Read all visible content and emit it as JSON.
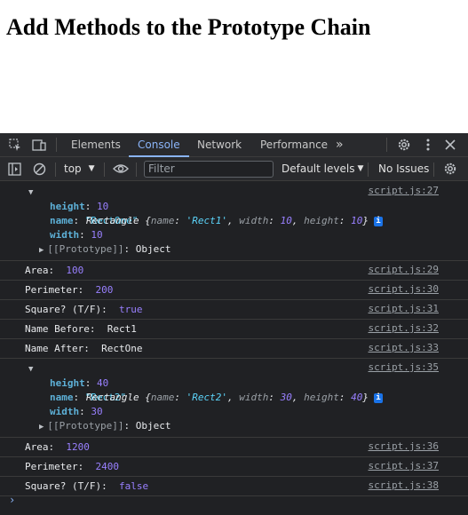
{
  "page": {
    "heading": "Add Methods to the Prototype Chain"
  },
  "devtools": {
    "tabs": [
      {
        "label": "Elements"
      },
      {
        "label": "Console"
      },
      {
        "label": "Network"
      },
      {
        "label": "Performance"
      }
    ],
    "more_tabs": "»",
    "toolbar": {
      "context": "top",
      "filter_placeholder": "Filter",
      "levels": "Default levels",
      "issues": "No Issues"
    }
  },
  "console": {
    "obj1": {
      "summary_prefix": "Rectangle",
      "summary": [
        {
          "k": "name",
          "v": "'Rect1'",
          "t": "str"
        },
        {
          "k": "width",
          "v": "10",
          "t": "num"
        },
        {
          "k": "height",
          "v": "10",
          "t": "num"
        }
      ],
      "props": [
        {
          "k": "height",
          "v": "10",
          "t": "num"
        },
        {
          "k": "name",
          "v": "\"RectOne\"",
          "t": "str"
        },
        {
          "k": "width",
          "v": "10",
          "t": "num"
        }
      ],
      "proto": "[[Prototype]]",
      "proto_val": "Object",
      "src": "script.js:27"
    },
    "lines1": [
      {
        "label": "Area:  ",
        "value": "100",
        "t": "num",
        "src": "script.js:29"
      },
      {
        "label": "Perimeter:  ",
        "value": "200",
        "t": "num",
        "src": "script.js:30"
      },
      {
        "label": "Square? (T/F):  ",
        "value": "true",
        "t": "num",
        "src": "script.js:31"
      },
      {
        "label": "Name Before:  ",
        "value": "Rect1",
        "t": "plain",
        "src": "script.js:32"
      },
      {
        "label": "Name After:  ",
        "value": "RectOne",
        "t": "plain",
        "src": "script.js:33"
      }
    ],
    "obj2": {
      "summary_prefix": "Rectangle",
      "summary": [
        {
          "k": "name",
          "v": "'Rect2'",
          "t": "str"
        },
        {
          "k": "width",
          "v": "30",
          "t": "num"
        },
        {
          "k": "height",
          "v": "40",
          "t": "num"
        }
      ],
      "props": [
        {
          "k": "height",
          "v": "40",
          "t": "num"
        },
        {
          "k": "name",
          "v": "\"Rect2\"",
          "t": "str"
        },
        {
          "k": "width",
          "v": "30",
          "t": "num"
        }
      ],
      "proto": "[[Prototype]]",
      "proto_val": "Object",
      "src": "script.js:35"
    },
    "lines2": [
      {
        "label": "Area:  ",
        "value": "1200",
        "t": "num",
        "src": "script.js:36"
      },
      {
        "label": "Perimeter:  ",
        "value": "2400",
        "t": "num",
        "src": "script.js:37"
      },
      {
        "label": "Square? (T/F):  ",
        "value": "false",
        "t": "num",
        "src": "script.js:38"
      }
    ]
  }
}
